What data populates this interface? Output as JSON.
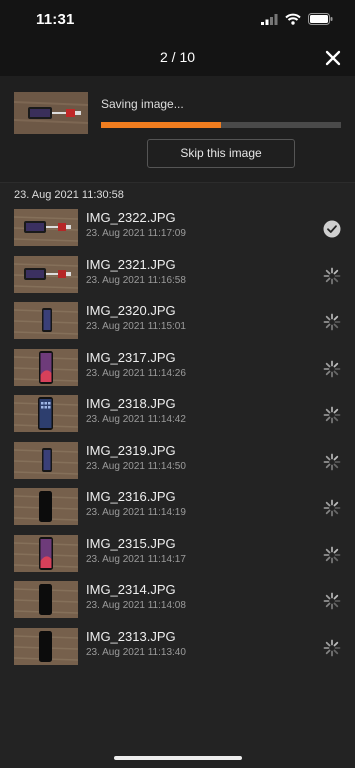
{
  "status_bar": {
    "time": "11:31"
  },
  "header": {
    "counter": "2 / 10"
  },
  "progress": {
    "label": "Saving image...",
    "fraction": 0.5,
    "skip_label": "Skip this image",
    "accent": "#f07d1f"
  },
  "section": {
    "title": "23. Aug 2021 11:30:58"
  },
  "items": [
    {
      "name": "IMG_2322.JPG",
      "date": "23. Aug 2021 11:17:09",
      "status": "done",
      "icon": "check-circle-icon",
      "thumb": "cable"
    },
    {
      "name": "IMG_2321.JPG",
      "date": "23. Aug 2021 11:16:58",
      "status": "pending",
      "icon": "spinner-icon",
      "thumb": "cable"
    },
    {
      "name": "IMG_2320.JPG",
      "date": "23. Aug 2021 11:15:01",
      "status": "pending",
      "icon": "spinner-icon",
      "thumb": "phone-small"
    },
    {
      "name": "IMG_2317.JPG",
      "date": "23. Aug 2021 11:14:26",
      "status": "pending",
      "icon": "spinner-icon",
      "thumb": "phone-wallpaper"
    },
    {
      "name": "IMG_2318.JPG",
      "date": "23. Aug 2021 11:14:42",
      "status": "pending",
      "icon": "spinner-icon",
      "thumb": "phone-homescreen"
    },
    {
      "name": "IMG_2319.JPG",
      "date": "23. Aug 2021 11:14:50",
      "status": "pending",
      "icon": "spinner-icon",
      "thumb": "phone-small"
    },
    {
      "name": "IMG_2316.JPG",
      "date": "23. Aug 2021 11:14:19",
      "status": "pending",
      "icon": "spinner-icon",
      "thumb": "phone-black"
    },
    {
      "name": "IMG_2315.JPG",
      "date": "23. Aug 2021 11:14:17",
      "status": "pending",
      "icon": "spinner-icon",
      "thumb": "phone-wallpaper"
    },
    {
      "name": "IMG_2314.JPG",
      "date": "23. Aug 2021 11:14:08",
      "status": "pending",
      "icon": "spinner-icon",
      "thumb": "phone-black"
    },
    {
      "name": "IMG_2313.JPG",
      "date": "23. Aug 2021 11:13:40",
      "status": "pending",
      "icon": "spinner-icon",
      "thumb": "phone-black"
    }
  ]
}
